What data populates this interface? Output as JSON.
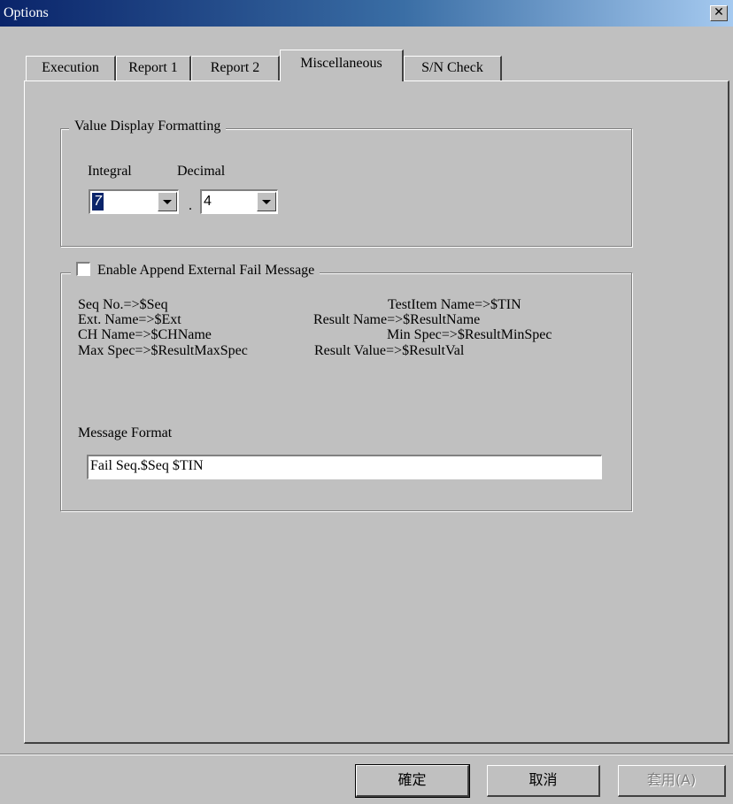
{
  "window": {
    "title": "Options"
  },
  "tabs": [
    {
      "label": "Execution"
    },
    {
      "label": "Report 1"
    },
    {
      "label": "Report 2"
    },
    {
      "label": "Miscellaneous"
    },
    {
      "label": "S/N Check"
    }
  ],
  "active_tab": "Miscellaneous",
  "value_display": {
    "legend": "Value Display Formatting",
    "integral_label": "Integral",
    "decimal_label": "Decimal",
    "integral_value": "7",
    "separator": ".",
    "decimal_value": "4"
  },
  "append_fail": {
    "checkbox_label": "Enable Append External Fail Message",
    "checked": false,
    "vars": [
      "Seq No.=>$Seq",
      "TestItem Name=>$TIN",
      "Ext. Name=>$Ext",
      "Result Name=>$ResultName",
      "CH Name=>$CHName",
      "Min Spec=>$ResultMinSpec",
      "Max Spec=>$ResultMaxSpec",
      "Result Value=>$ResultVal"
    ],
    "message_format_label": "Message Format",
    "message_format_value": "Fail Seq.$Seq  $TIN"
  },
  "buttons": {
    "ok": "確定",
    "cancel": "取消",
    "apply": "套用(A)"
  }
}
